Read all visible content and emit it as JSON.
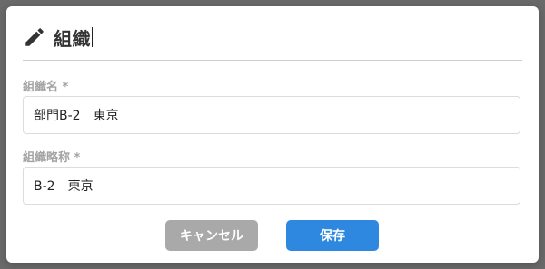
{
  "dialog": {
    "title": "組織",
    "title_icon": "pencil-icon"
  },
  "fields": [
    {
      "label": "組織名 *",
      "value": "部門B-2　東京"
    },
    {
      "label": "組織略称 *",
      "value": "B-2　東京"
    }
  ],
  "buttons": {
    "cancel_label": "キャンセル",
    "save_label": "保存"
  },
  "colors": {
    "save": "#2f88e0",
    "cancel": "#a9a9a9",
    "label": "#a3a3a3"
  }
}
